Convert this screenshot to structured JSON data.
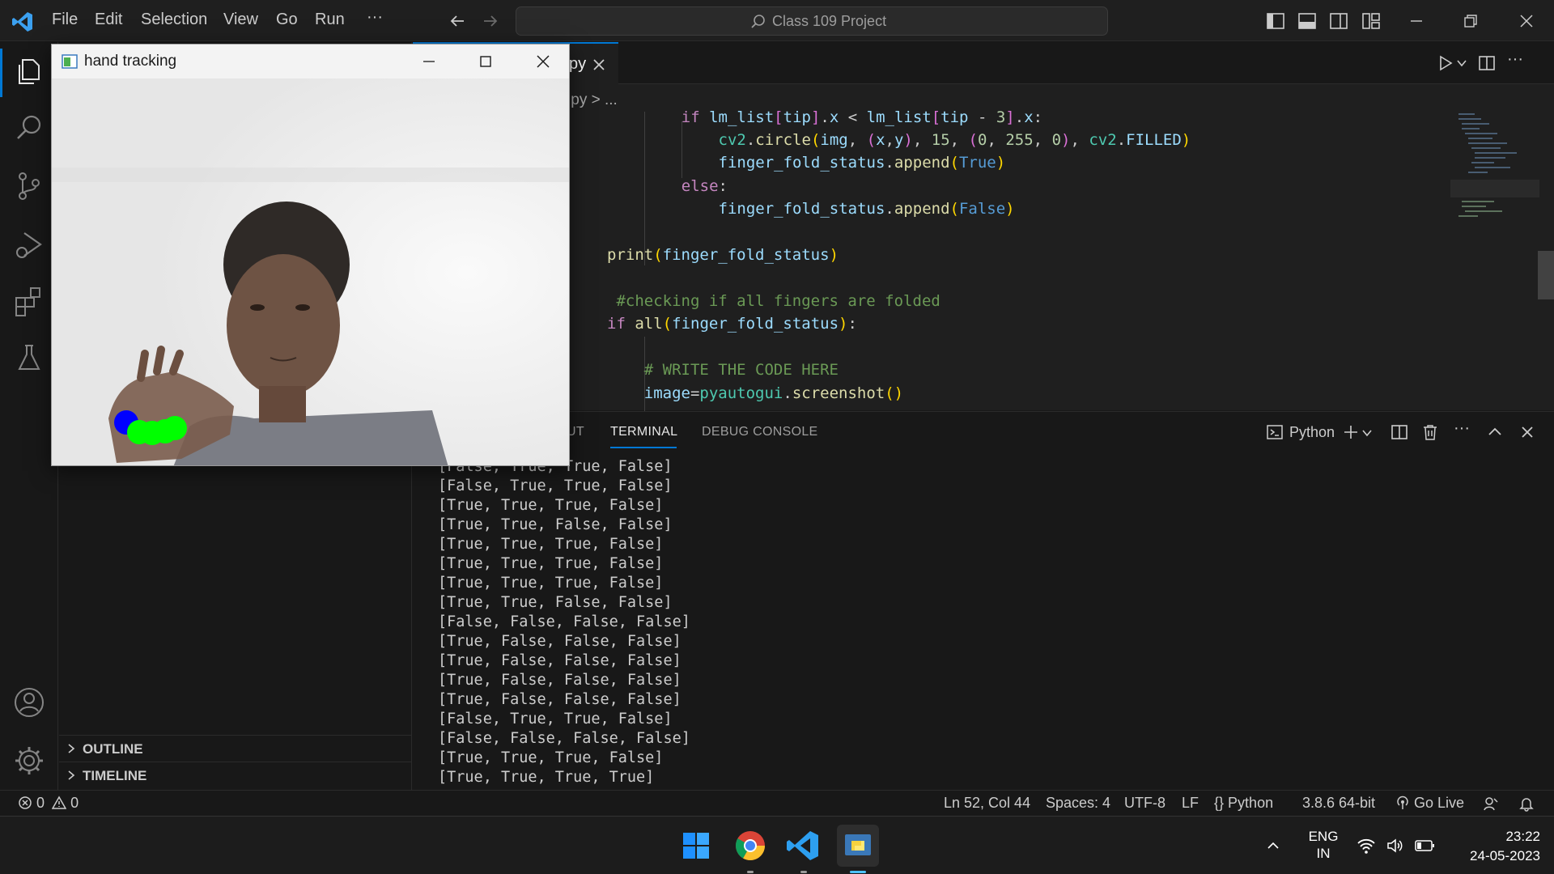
{
  "titlebar": {
    "menu": [
      "File",
      "Edit",
      "Selection",
      "View",
      "Go",
      "Run"
    ],
    "more": "···",
    "command_center": "Class 109 Project"
  },
  "sidebar": {
    "sections": [
      {
        "label": "OUTLINE"
      },
      {
        "label": "TIMELINE"
      }
    ]
  },
  "editor": {
    "tab_label": "py",
    "breadcrumb": ".py > ..."
  },
  "panel": {
    "tabs": [
      "UT",
      "TERMINAL",
      "DEBUG CONSOLE"
    ],
    "terminal_profile": "Python",
    "terminal_lines": [
      "[False, True, True, False]",
      "[False, True, True, False]",
      "[True, True, True, False]",
      "[True, True, False, False]",
      "[True, True, True, False]",
      "[True, True, True, False]",
      "[True, True, True, False]",
      "[True, True, False, False]",
      "[False, False, False, False]",
      "[True, False, False, False]",
      "[True, False, False, False]",
      "[True, False, False, False]",
      "[True, False, False, False]",
      "[False, True, True, False]",
      "[False, False, False, False]",
      "[True, True, True, False]",
      "[True, True, True, True]"
    ]
  },
  "statusbar": {
    "errors": "0",
    "warnings": "0",
    "cursor": "Ln 52, Col 44",
    "spaces": "Spaces: 4",
    "encoding": "UTF-8",
    "eol": "LF",
    "language": "Python",
    "interpreter": "3.8.6 64-bit",
    "golive": "Go Live"
  },
  "taskbar": {
    "lang_top": "ENG",
    "lang_bottom": "IN",
    "time": "23:22",
    "date": "24-05-2023"
  },
  "hand_window": {
    "title": "hand tracking"
  },
  "colors": {
    "accent": "#0078d4",
    "editor_bg": "#1f1f1f",
    "landmark_blue": "#0000ff",
    "landmark_green": "#00ff00"
  }
}
